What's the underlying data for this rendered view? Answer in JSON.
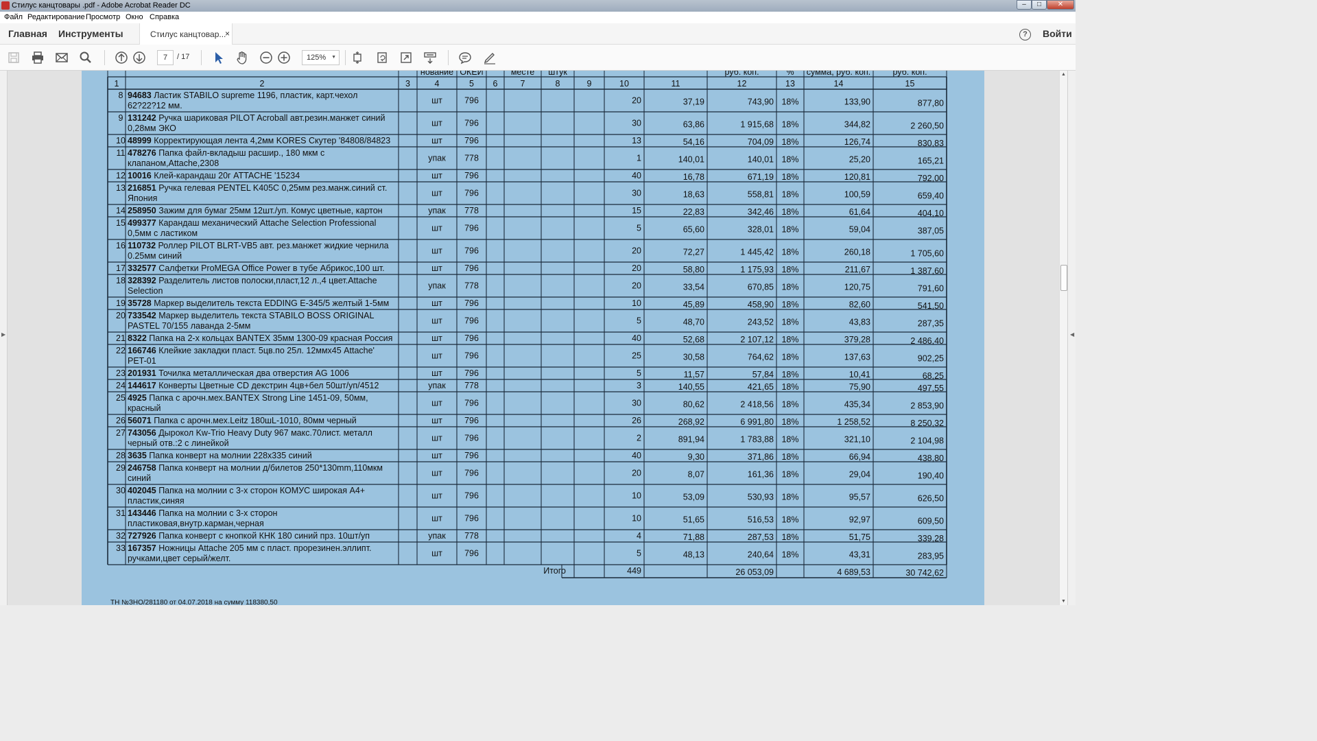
{
  "window": {
    "title": "Стилус канцтовары .pdf - Adobe Acrobat Reader DC",
    "controls": [
      "–",
      "□",
      "✕"
    ]
  },
  "menu": [
    "Файл",
    "Редактирование",
    "Просмотр",
    "Окно",
    "Справка"
  ],
  "tabs": {
    "home": "Главная",
    "tools": "Инструменты",
    "document": "Стилус канцтовар...",
    "close": "×",
    "help": "?",
    "login": "Войти"
  },
  "toolbar": {
    "page_current": "7",
    "page_total": "/ 17",
    "zoom": "125%",
    "icons": [
      "save-icon",
      "print-icon",
      "email-icon",
      "search-icon",
      "prev-page-icon",
      "next-page-icon",
      "select-arrow-icon",
      "hand-icon",
      "zoom-out-icon",
      "zoom-in-icon",
      "fit-page-icon",
      "rotate-icon",
      "fullscreen-icon",
      "scroll-mode-icon",
      "comment-icon",
      "sign-icon"
    ]
  },
  "table": {
    "header_partial": [
      "",
      "",
      "",
      "нование",
      "ОКЕИ",
      "",
      "месте",
      "штук",
      "",
      "",
      "",
      "руб. коп.",
      "%",
      "сумма, руб. коп.",
      "руб. коп."
    ],
    "column_numbers": [
      "1",
      "2",
      "3",
      "4",
      "5",
      "6",
      "7",
      "8",
      "9",
      "10",
      "11",
      "12",
      "13",
      "14",
      "15"
    ],
    "rows": [
      {
        "n": "8",
        "code": "94683",
        "l1": "Ластик STABILO supreme 1196, пластик, карт.чехол",
        "l2": "62?22?12 мм.",
        "unit": "шт",
        "okei": "796",
        "qty": "20",
        "price": "37,19",
        "sum": "743,90",
        "vat": "18%",
        "vatsum": "133,90",
        "total": "877,80"
      },
      {
        "n": "9",
        "code": "131242",
        "l1": "Ручка шариковая PILOT Acroball авт.резин.манжет синий",
        "l2": "0,28мм ЭКО",
        "unit": "шт",
        "okei": "796",
        "qty": "30",
        "price": "63,86",
        "sum": "1 915,68",
        "vat": "18%",
        "vatsum": "344,82",
        "total": "2 260,50"
      },
      {
        "n": "10",
        "code": "48999",
        "l1": "Корректирующая лента 4,2мм KORES  Скутер  '84808/84823",
        "l2": "",
        "unit": "шт",
        "okei": "796",
        "qty": "13",
        "price": "54,16",
        "sum": "704,09",
        "vat": "18%",
        "vatsum": "126,74",
        "total": "830,83"
      },
      {
        "n": "11",
        "code": "478276",
        "l1": "Папка файл-вкладыш расшир., 180 мкм с",
        "l2": "клапаном,Attache,2308",
        "unit": "упак",
        "okei": "778",
        "qty": "1",
        "price": "140,01",
        "sum": "140,01",
        "vat": "18%",
        "vatsum": "25,20",
        "total": "165,21"
      },
      {
        "n": "12",
        "code": "10016",
        "l1": "Клей-карандаш 20г ATTACHE '15234",
        "l2": "",
        "unit": "шт",
        "okei": "796",
        "qty": "40",
        "price": "16,78",
        "sum": "671,19",
        "vat": "18%",
        "vatsum": "120,81",
        "total": "792,00"
      },
      {
        "n": "13",
        "code": "216851",
        "l1": "Ручка гелевая PENTEL K405C 0,25мм рез.манж.синий ст.",
        "l2": "Япония",
        "unit": "шт",
        "okei": "796",
        "qty": "30",
        "price": "18,63",
        "sum": "558,81",
        "vat": "18%",
        "vatsum": "100,59",
        "total": "659,40"
      },
      {
        "n": "14",
        "code": "258950",
        "l1": "Зажим для бумаг 25мм 12шт./уп. Комус цветные, картон",
        "l2": "",
        "unit": "упак",
        "okei": "778",
        "qty": "15",
        "price": "22,83",
        "sum": "342,46",
        "vat": "18%",
        "vatsum": "61,64",
        "total": "404,10"
      },
      {
        "n": "15",
        "code": "499377",
        "l1": "Карандаш механический Attache Selection Professional",
        "l2": "0,5мм с ластиком",
        "unit": "шт",
        "okei": "796",
        "qty": "5",
        "price": "65,60",
        "sum": "328,01",
        "vat": "18%",
        "vatsum": "59,04",
        "total": "387,05"
      },
      {
        "n": "16",
        "code": "110732",
        "l1": "Роллер PILOT BLRT-VB5 авт. рез.манжет жидкие чернила",
        "l2": "0.25мм синий",
        "unit": "шт",
        "okei": "796",
        "qty": "20",
        "price": "72,27",
        "sum": "1 445,42",
        "vat": "18%",
        "vatsum": "260,18",
        "total": "1 705,60"
      },
      {
        "n": "17",
        "code": "332577",
        "l1": "Салфетки ProMEGA Office  Power  в тубе Абрикос,100 шт.",
        "l2": "",
        "unit": "шт",
        "okei": "796",
        "qty": "20",
        "price": "58,80",
        "sum": "1 175,93",
        "vat": "18%",
        "vatsum": "211,67",
        "total": "1 387,60"
      },
      {
        "n": "18",
        "code": "328392",
        "l1": "Разделитель листов полоски,пласт,12 л.,4 цвет.Attache",
        "l2": "Selection",
        "unit": "упак",
        "okei": "778",
        "qty": "20",
        "price": "33,54",
        "sum": "670,85",
        "vat": "18%",
        "vatsum": "120,75",
        "total": "791,60"
      },
      {
        "n": "19",
        "code": "35728",
        "l1": "Маркер выделитель текста EDDING E-345/5 желтый 1-5мм",
        "l2": "",
        "unit": "шт",
        "okei": "796",
        "qty": "10",
        "price": "45,89",
        "sum": "458,90",
        "vat": "18%",
        "vatsum": "82,60",
        "total": "541,50"
      },
      {
        "n": "20",
        "code": "733542",
        "l1": "Маркер выделитель текста STABILO BOSS ORIGINAL",
        "l2": "PASTEL 70/155 лаванда 2-5мм",
        "unit": "шт",
        "okei": "796",
        "qty": "5",
        "price": "48,70",
        "sum": "243,52",
        "vat": "18%",
        "vatsum": "43,83",
        "total": "287,35"
      },
      {
        "n": "21",
        "code": "8322",
        "l1": "Папка на 2-х кольцах BANTEX 35мм 1300-09 красная Россия",
        "l2": "",
        "unit": "шт",
        "okei": "796",
        "qty": "40",
        "price": "52,68",
        "sum": "2 107,12",
        "vat": "18%",
        "vatsum": "379,28",
        "total": "2 486,40"
      },
      {
        "n": "22",
        "code": "166746",
        "l1": "Клейкие закладки пласт. 5цв.по 25л. 12ммх45 Attache'",
        "l2": "PET-01",
        "unit": "шт",
        "okei": "796",
        "qty": "25",
        "price": "30,58",
        "sum": "764,62",
        "vat": "18%",
        "vatsum": "137,63",
        "total": "902,25"
      },
      {
        "n": "23",
        "code": "201931",
        "l1": "Точилка металлическая два отверстия AG 1006",
        "l2": "",
        "unit": "шт",
        "okei": "796",
        "qty": "5",
        "price": "11,57",
        "sum": "57,84",
        "vat": "18%",
        "vatsum": "10,41",
        "total": "68,25"
      },
      {
        "n": "24",
        "code": "144617",
        "l1": "Конверты Цветные CD декстрин 4цв+бел 50шт/уп/4512",
        "l2": "",
        "unit": "упак",
        "okei": "778",
        "qty": "3",
        "price": "140,55",
        "sum": "421,65",
        "vat": "18%",
        "vatsum": "75,90",
        "total": "497,55"
      },
      {
        "n": "25",
        "code": "4925",
        "l1": "Папка с арочн.мех.BANTEX Strong Line 1451-09, 50мм,",
        "l2": "красный",
        "unit": "шт",
        "okei": "796",
        "qty": "30",
        "price": "80,62",
        "sum": "2 418,56",
        "vat": "18%",
        "vatsum": "435,34",
        "total": "2 853,90"
      },
      {
        "n": "26",
        "code": "56071",
        "l1": "Папка с арочн.мех.Leitz 180шL-1010, 80мм черный",
        "l2": "",
        "unit": "шт",
        "okei": "796",
        "qty": "26",
        "price": "268,92",
        "sum": "6 991,80",
        "vat": "18%",
        "vatsum": "1 258,52",
        "total": "8 250,32"
      },
      {
        "n": "27",
        "code": "743056",
        "l1": "Дырокол Kw-Trio Heavy Duty 967 макс.70лист. металл",
        "l2": "черный отв.:2 с линейкой",
        "unit": "шт",
        "okei": "796",
        "qty": "2",
        "price": "891,94",
        "sum": "1 783,88",
        "vat": "18%",
        "vatsum": "321,10",
        "total": "2 104,98"
      },
      {
        "n": "28",
        "code": "3635",
        "l1": "Папка конверт на молнии 228x335 синий",
        "l2": "",
        "unit": "шт",
        "okei": "796",
        "qty": "40",
        "price": "9,30",
        "sum": "371,86",
        "vat": "18%",
        "vatsum": "66,94",
        "total": "438,80"
      },
      {
        "n": "29",
        "code": "246758",
        "l1": "Папка конверт на молнии д/билетов 250*130mm,110мкм",
        "l2": "синий",
        "unit": "шт",
        "okei": "796",
        "qty": "20",
        "price": "8,07",
        "sum": "161,36",
        "vat": "18%",
        "vatsum": "29,04",
        "total": "190,40"
      },
      {
        "n": "30",
        "code": "402045",
        "l1": "Папка на молнии с 3-х сторон КОМУС широкая А4+",
        "l2": "пластик,синяя",
        "unit": "шт",
        "okei": "796",
        "qty": "10",
        "price": "53,09",
        "sum": "530,93",
        "vat": "18%",
        "vatsum": "95,57",
        "total": "626,50"
      },
      {
        "n": "31",
        "code": "143446",
        "l1": "Папка на молнии с 3-х сторон",
        "l2": "пластиковая,внутр.карман,черная",
        "unit": "шт",
        "okei": "796",
        "qty": "10",
        "price": "51,65",
        "sum": "516,53",
        "vat": "18%",
        "vatsum": "92,97",
        "total": "609,50"
      },
      {
        "n": "32",
        "code": "727926",
        "l1": "Папка конверт с кнопкой КНК 180 синий прз. 10шт/уп",
        "l2": "",
        "unit": "упак",
        "okei": "778",
        "qty": "4",
        "price": "71,88",
        "sum": "287,53",
        "vat": "18%",
        "vatsum": "51,75",
        "total": "339,28"
      },
      {
        "n": "33",
        "code": "167357",
        "l1": "Ножницы Attache 205 мм с пласт. прорезинен.эллипт.",
        "l2": "ручками,цвет серый/желт.",
        "unit": "шт",
        "okei": "796",
        "qty": "5",
        "price": "48,13",
        "sum": "240,64",
        "vat": "18%",
        "vatsum": "43,31",
        "total": "283,95"
      }
    ],
    "totals": {
      "label": "Итого",
      "qty": "449",
      "sum": "26 053,09",
      "vatsum": "4 689,53",
      "total": "30 742,62"
    },
    "footnote": "ТН №ЗНО/281180 от 04.07.2018 на сумму 118380,50"
  },
  "colors": {
    "page_bg": "#9bc3df",
    "grid": "#1a2a3a",
    "text": "#111111"
  }
}
